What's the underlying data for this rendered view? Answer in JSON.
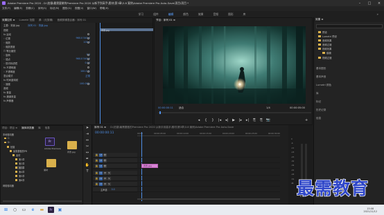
{
  "window": {
    "title": "Adobe Premiere Pro 2020 - D:\\拍摄\\最需要做的Premiere Pro 2020 从新手到高手\\素材\\第3章\\3.8 案例\\Adobe Premiere Pro Auto-Save\\项目\\项目 *",
    "minimize": "–",
    "maximize": "□",
    "close": "×"
  },
  "menu": [
    "文件(F)",
    "编辑(E)",
    "剪辑(C)",
    "序列(S)",
    "标记(M)",
    "图形(G)",
    "视图(V)",
    "窗口(W)",
    "帮助(H)"
  ],
  "workspaces": {
    "items": [
      "学习",
      "组件",
      "编辑",
      "颜色",
      "效果",
      "音频",
      "图形",
      "库"
    ],
    "active": "编辑",
    "more": "»"
  },
  "effect_controls": {
    "tabs": [
      "效果控件 ≡",
      "Lumetri 范围",
      "源：(无剪辑)",
      "音频剪辑混合器：序列 01"
    ],
    "source": "主要：背景.jpg",
    "clip": "序列 01 · 背景.jpg",
    "rows": [
      {
        "label": "视频",
        "value": ""
      },
      {
        "label": "fx  运动",
        "value": ""
      },
      {
        "label": "  ◦ 位置",
        "value": "960.0  540.0"
      },
      {
        "label": "  ◦ 缩放",
        "value": "100.0"
      },
      {
        "label": "  ◦ 缩放宽度",
        "value": ""
      },
      {
        "label": "  ☐ 等比缩放",
        "value": ""
      },
      {
        "label": "  ◦ 旋转",
        "value": "0.0"
      },
      {
        "label": "  ◦ 锚点",
        "value": "960.0  540.0"
      },
      {
        "label": "  ◦ 防闪烁滤镜",
        "value": "0.00"
      },
      {
        "label": "fx  不透明度",
        "value": ""
      },
      {
        "label": "  ◦ 不透明度",
        "value": "100.0 %"
      },
      {
        "label": "    混合模式",
        "value": "正常"
      },
      {
        "label": "fx  时间重映射",
        "value": ""
      },
      {
        "label": "  ◦ 速度",
        "value": "100.00%"
      },
      {
        "label": "音频",
        "value": ""
      },
      {
        "label": "fx  音量",
        "value": ""
      },
      {
        "label": "fx  通道音量",
        "value": ""
      },
      {
        "label": "fx  声像器",
        "value": ""
      }
    ],
    "clip_bar": "背景.jpg"
  },
  "program": {
    "tab": "节目：序列 01 ≡",
    "timecode_left": "00:00:00:11",
    "fit": "适合",
    "quality": "1/4",
    "timecode_right": "00:00:05:00",
    "controls": [
      "◂",
      "|",
      "{",
      "}",
      "|◂",
      "◂|",
      "▶",
      "|▸",
      "▸|",
      "⎘",
      "⎘",
      "📷",
      "+"
    ]
  },
  "right_panel": {
    "title": "效果 ≡",
    "search_placeholder": "",
    "items": [
      "预设",
      "Lumetri 预设",
      "音频效果",
      "音频过渡",
      "视频效果",
      "模糊",
      "视频过渡"
    ],
    "sections": [
      "基本图形",
      "基本声音",
      "Lumetri 颜色",
      "库",
      "标记",
      "历史记录",
      "信息"
    ]
  },
  "project": {
    "tabs": [
      "项目：项目 ≡",
      "媒体浏览器",
      "库",
      "信息"
    ],
    "tree": [
      "本地驱动器",
      "C:",
      "D:",
      "拍摄",
      "最需要做的PR",
      "素材",
      "第1章",
      "第2章",
      "第3章",
      "第4章",
      "第5章",
      "第6章",
      "网络驱动器"
    ],
    "files": [
      {
        "name": "Adobe Premiere",
        "type": "folder"
      },
      {
        "name": "背景.jpg",
        "type": "file"
      },
      {
        "name": "素材",
        "type": "folder"
      }
    ]
  },
  "timeline": {
    "tab": "序列 01 ≡",
    "timecode": "00:00:00:11",
    "path": "D:\\拍摄\\最需要做的Premiere Pro 2020 从新手到高手\\素材\\第3章\\3.8 案例\\Adobe Premiere Pro Auto-Save",
    "ruler": [
      "00:00",
      "00:00:05:00",
      "00:00:10:00",
      "00:00:15:00",
      "00:00:20:00",
      "00:00:25:00",
      "00:00:30:00"
    ],
    "video_tracks": [
      {
        "id": "V3",
        "clip": ""
      },
      {
        "id": "V2",
        "clip": ""
      },
      {
        "id": "V1",
        "clip": "背景.jpg"
      }
    ],
    "audio_tracks": [
      {
        "id": "A1",
        "clip": ""
      },
      {
        "id": "A2",
        "clip": ""
      },
      {
        "id": "A3",
        "clip": ""
      }
    ],
    "master_label": "主声道",
    "master_value": "0.0"
  },
  "meters": {
    "scale": [
      "0",
      "-6",
      "-12",
      "-18",
      "-24",
      "-30",
      "-36",
      "-42",
      "-48",
      "-54",
      "dB"
    ],
    "solo": "S  S"
  },
  "taskbar": {
    "clock_time": "15:08",
    "clock_date": "2021/11/12",
    "icons": [
      "windows-start",
      "search",
      "task-view",
      "edge",
      "explorer",
      "premiere",
      "photos"
    ]
  },
  "watermark": "最需教育",
  "colors": {
    "accent": "#4f8fe6",
    "clip": "#d784d4",
    "folder": "#d9b04b"
  }
}
